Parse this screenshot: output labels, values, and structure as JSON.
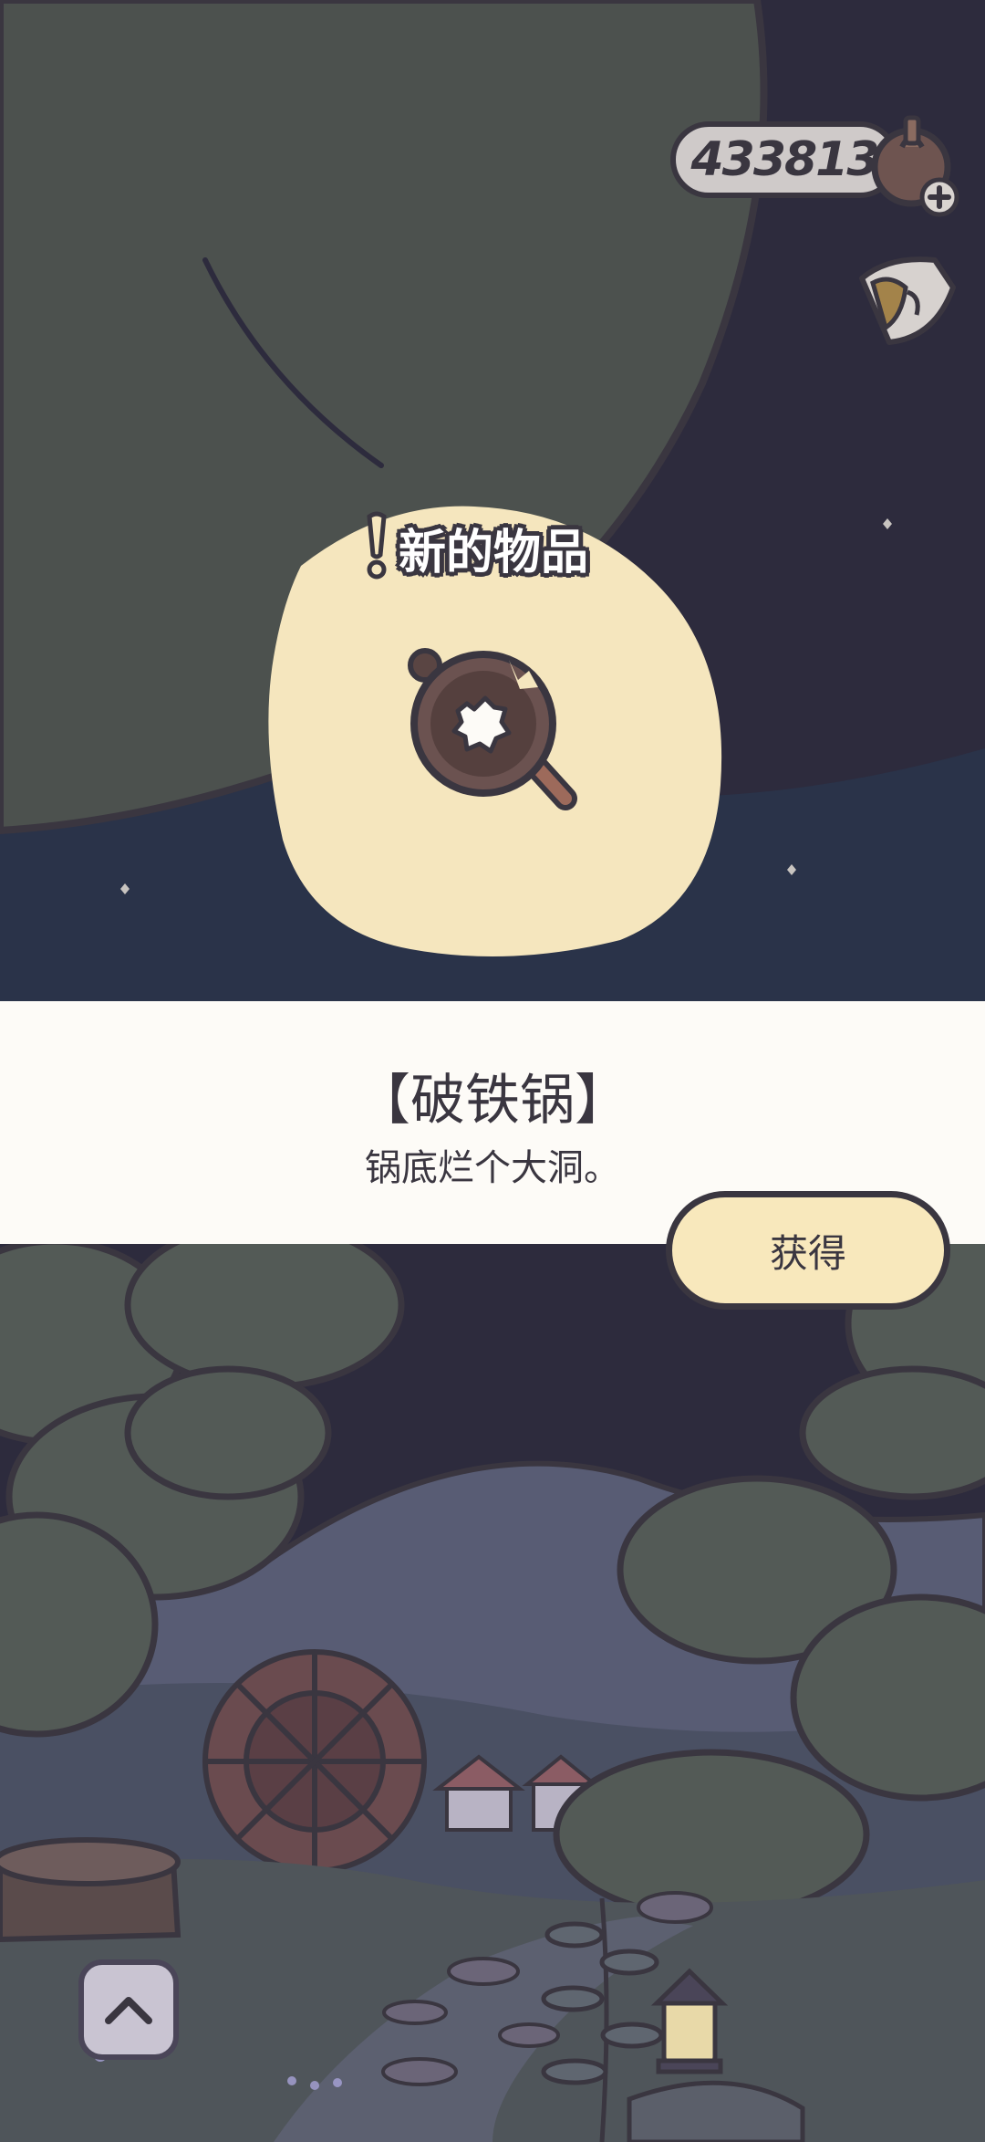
{
  "hud": {
    "currency_value": "433813",
    "currency_icon": "clover-coin-icon",
    "add_currency_icon": "plus-icon",
    "album_icon": "postcard-album-icon"
  },
  "notice": {
    "icon": "exclamation-icon",
    "text": "新的物品"
  },
  "item": {
    "icon": "broken-pan-icon",
    "name": "【破铁锅】",
    "description": "锅底烂个大洞。"
  },
  "actions": {
    "obtain_label": "获得",
    "expand_icon": "chevron-up-icon"
  },
  "colors": {
    "sky": "#2d2b3d",
    "moon": "#4c514e",
    "outline": "#3a3640",
    "highlight_blob": "#f5e6be",
    "panel": "#fdfbf7",
    "button": "#f8e8bc"
  }
}
